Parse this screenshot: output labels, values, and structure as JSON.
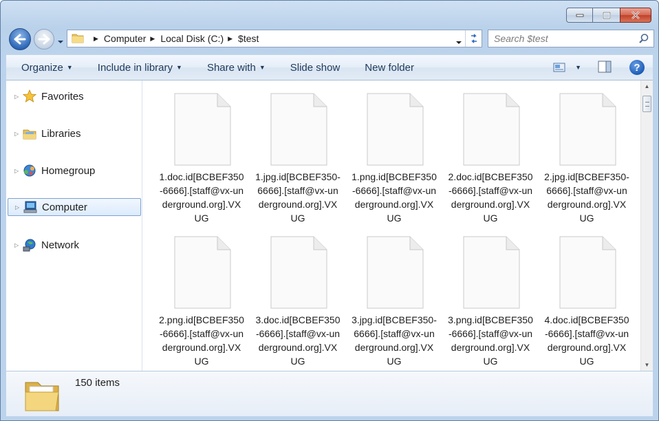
{
  "window": {
    "caption": {
      "minimize": "minimize",
      "maximize": "maximize",
      "close": "close"
    }
  },
  "address_bar": {
    "crumbs": [
      "Computer",
      "Local Disk (C:)",
      "$test"
    ]
  },
  "search": {
    "placeholder": "Search $test"
  },
  "commands": {
    "organize": "Organize",
    "include_in_library": "Include in library",
    "share_with": "Share with",
    "slide_show": "Slide show",
    "new_folder": "New folder",
    "help": "?"
  },
  "nav_pane": {
    "items": [
      {
        "label": "Favorites",
        "icon": "star-icon"
      },
      {
        "label": "Libraries",
        "icon": "library-icon"
      },
      {
        "label": "Homegroup",
        "icon": "homegroup-icon"
      },
      {
        "label": "Computer",
        "icon": "computer-icon",
        "selected": true
      },
      {
        "label": "Network",
        "icon": "network-icon"
      }
    ]
  },
  "files": [
    {
      "name": "1.doc.id[BCBEF350-6666].[staff@vx-underground.org].VXUG"
    },
    {
      "name": "1.jpg.id[BCBEF350-6666].[staff@vx-underground.org].VXUG"
    },
    {
      "name": "1.png.id[BCBEF350-6666].[staff@vx-underground.org].VXUG"
    },
    {
      "name": "2.doc.id[BCBEF350-6666].[staff@vx-underground.org].VXUG"
    },
    {
      "name": "2.jpg.id[BCBEF350-6666].[staff@vx-underground.org].VXUG"
    },
    {
      "name": "2.png.id[BCBEF350-6666].[staff@vx-underground.org].VXUG"
    },
    {
      "name": "3.doc.id[BCBEF350-6666].[staff@vx-underground.org].VXUG"
    },
    {
      "name": "3.jpg.id[BCBEF350-6666].[staff@vx-underground.org].VXUG"
    },
    {
      "name": "3.png.id[BCBEF350-6666].[staff@vx-underground.org].VXUG"
    },
    {
      "name": "4.doc.id[BCBEF350-6666].[staff@vx-underground.org].VXUG"
    }
  ],
  "details": {
    "item_count": "150 items"
  },
  "colors": {
    "chrome": "#bcd3ec",
    "accent": "#2e68b8",
    "selection": "#dcebfc"
  }
}
